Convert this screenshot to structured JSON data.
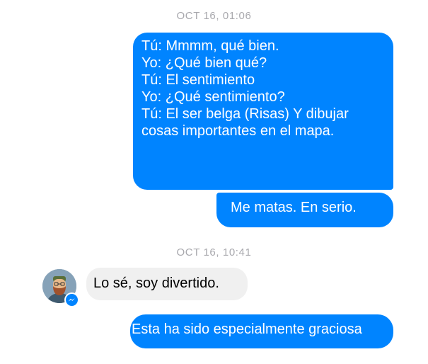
{
  "conversation": {
    "timestamp_1": "OCT 16, 01:06",
    "message_1": {
      "lines": [
        "Tú: Mmmm, qué bien.",
        "Yo: ¿Qué bien qué?",
        "Tú: El sentimiento",
        "Yo: ¿Qué sentimiento?",
        "Tú: El ser belga (Risas) Y dibujar",
        "cosas importantes en el mapa."
      ]
    },
    "message_2": {
      "text": "Me matas. En serio."
    },
    "timestamp_2": "OCT 16, 10:41",
    "message_3": {
      "text": "Lo sé, soy divertido.",
      "avatar_icon": "user-avatar",
      "badge_icon": "messenger-icon"
    },
    "message_4": {
      "text": "Esta ha sido especialmente graciosa"
    }
  },
  "colors": {
    "outgoing_bubble": "#0084ff",
    "incoming_bubble": "#f0f0f0",
    "timestamp": "#a8a8ad"
  }
}
